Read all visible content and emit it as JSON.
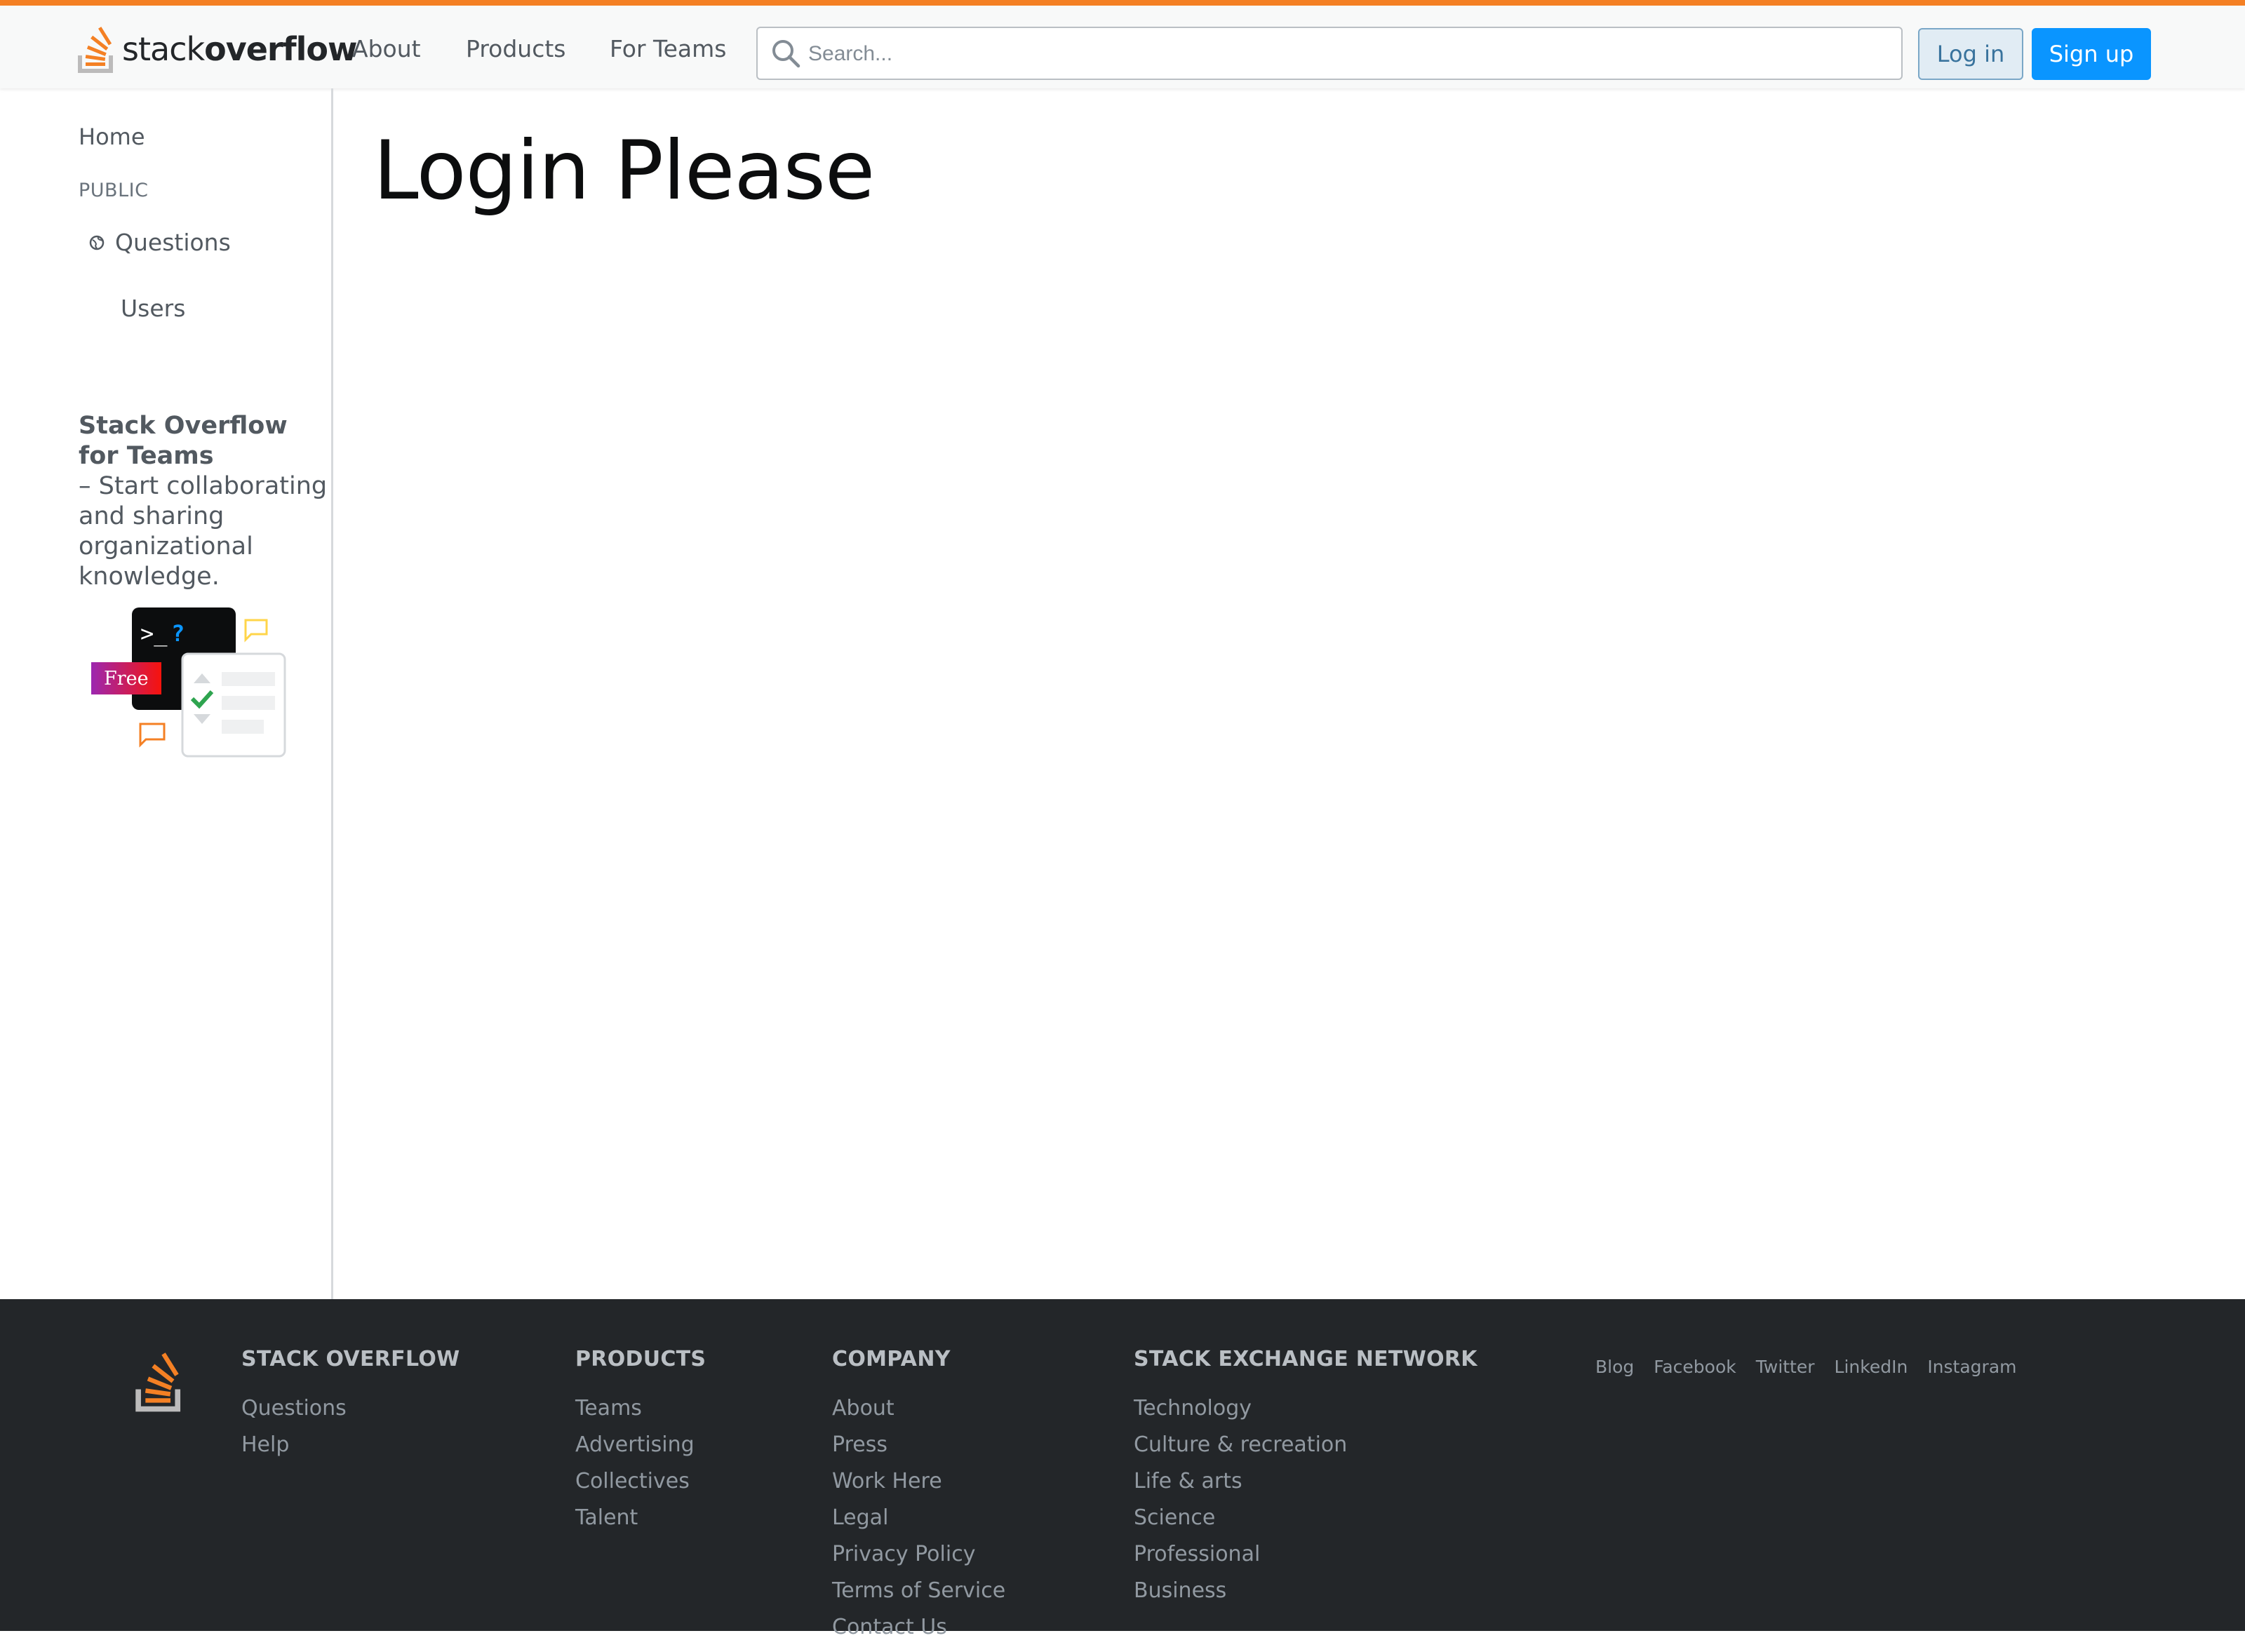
{
  "header": {
    "logo_text_light": "stack",
    "logo_text_bold": "overflow",
    "nav": [
      "About",
      "Products",
      "For Teams"
    ],
    "search_placeholder": "Search...",
    "login_label": "Log in",
    "signup_label": "Sign up",
    "accent_color": "#f48024"
  },
  "sidebar": {
    "home": "Home",
    "section_label": "PUBLIC",
    "questions": "Questions",
    "users": "Users",
    "teams_title": "Stack Overflow for Teams",
    "teams_text": "– Start collaborating and sharing organizational knowledge.",
    "free_badge": "Free",
    "terminal_prompt": ">_",
    "terminal_question": "?"
  },
  "main": {
    "title": "Login Please"
  },
  "footer": {
    "columns": [
      {
        "heading": "STACK OVERFLOW",
        "links": [
          "Questions",
          "Help"
        ]
      },
      {
        "heading": "PRODUCTS",
        "links": [
          "Teams",
          "Advertising",
          "Collectives",
          "Talent"
        ]
      },
      {
        "heading": "COMPANY",
        "links": [
          "About",
          "Press",
          "Work Here",
          "Legal",
          "Privacy Policy",
          "Terms of Service",
          "Contact Us"
        ]
      },
      {
        "heading": "STACK EXCHANGE NETWORK",
        "links": [
          "Technology",
          "Culture & recreation",
          "Life & arts",
          "Science",
          "Professional",
          "Business"
        ]
      }
    ],
    "social": [
      "Blog",
      "Facebook",
      "Twitter",
      "LinkedIn",
      "Instagram"
    ],
    "background_color": "#232629"
  },
  "icons": {
    "logo": "stack-overflow-logo-icon",
    "search": "search-icon",
    "globe": "globe-icon",
    "footer_logo": "stack-overflow-logo-icon"
  }
}
